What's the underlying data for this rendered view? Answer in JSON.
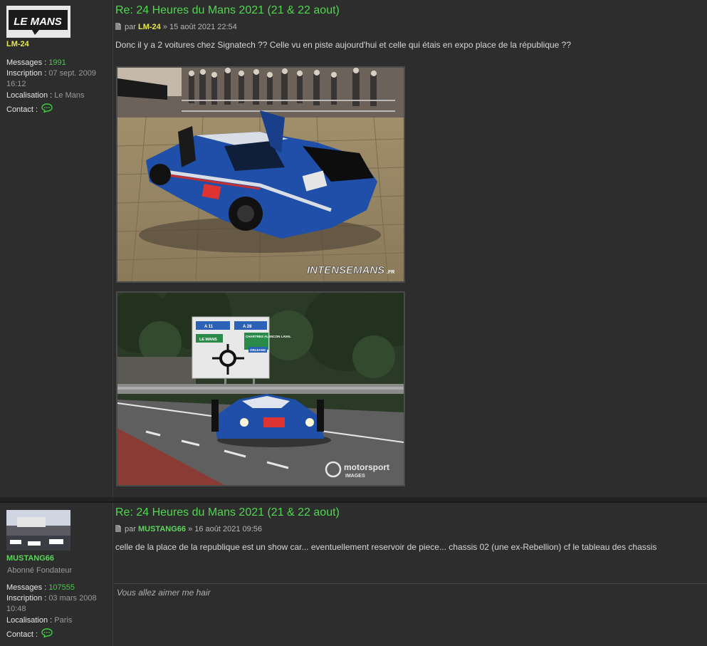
{
  "posts": [
    {
      "author": "LM-24",
      "author_color": "#e8e84a",
      "rank": "",
      "messages_label": "Messages :",
      "messages": "1991",
      "inscription_label": "Inscription :",
      "inscription_date": "07 sept. 2009",
      "inscription_time": "16:12",
      "localisation_label": "Localisation :",
      "localisation": "Le Mans",
      "contact_label": "Contact :",
      "avatar_text": "LE MANS",
      "title": "Re: 24 Heures du Mans 2021 (21 & 22 aout)",
      "by_label": "par",
      "date": "» 15 août 2021 22:54",
      "text": "Donc il y a 2 voitures chez Signatech ?? Celle vu en piste aujourd'hui et celle qui étais en expo place de la république ??",
      "images": [
        {
          "watermark": "INTENSEMANS",
          "watermark_suffix": ".FR"
        },
        {
          "watermark": "motorsport",
          "watermark_sub": "IMAGES",
          "sign_left_top": "A 11",
          "sign_right_top": "A 28",
          "sign_le_mans": "LE MANS",
          "sign_right_list": "CHARTRES ALENCON LAVAL",
          "sign_orleans": "ORLEANS"
        }
      ]
    },
    {
      "author": "MUSTANG66",
      "author_color": "#5cd65c",
      "rank": "Abonné Fondateur",
      "messages_label": "Messages :",
      "messages": "107555",
      "inscription_label": "Inscription :",
      "inscription_date": "03 mars 2008",
      "inscription_time": "10:48",
      "localisation_label": "Localisation :",
      "localisation": "Paris",
      "contact_label": "Contact :",
      "title": "Re: 24 Heures du Mans 2021 (21 & 22 aout)",
      "by_label": "par",
      "date": "» 16 août 2021 09:56",
      "text": "celle de la place de la republique est un show car... eventuellement reservoir de piece... chassis 02 (une ex-Rebellion) cf le tableau des chassis",
      "signature": "Vous allez aimer me hair"
    }
  ],
  "icons": {
    "post_icon": "file-icon",
    "contact_icon": "chat-bubble-icon"
  },
  "colors": {
    "title": "#4fd84f",
    "accent_green": "#3fcf3f",
    "post_bg": "#2d2d2d"
  }
}
